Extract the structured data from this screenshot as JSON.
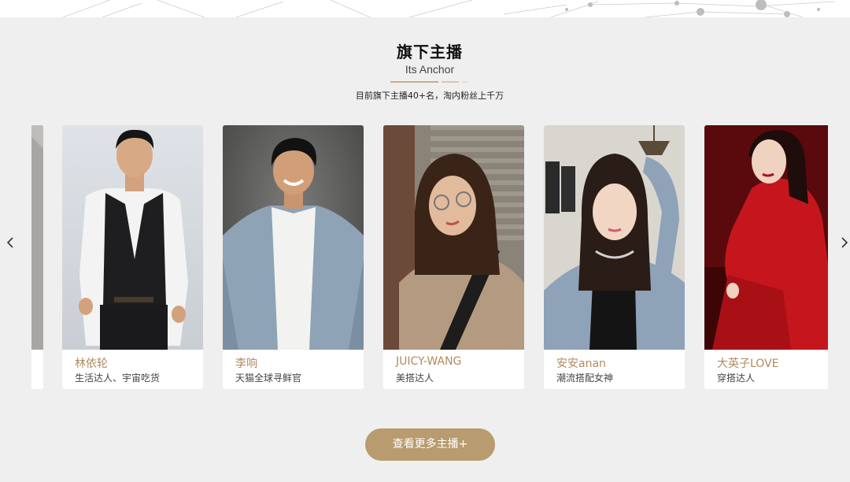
{
  "section": {
    "title": "旗下主播",
    "subtitle": "Its Anchor",
    "description": "目前旗下主播40+名，淘内粉丝上千万"
  },
  "carousel": {
    "prev_icon": "chevron-left-icon",
    "next_icon": "chevron-right-icon",
    "anchors": [
      {
        "name": "林依轮",
        "role": "生活达人、宇宙吃货"
      },
      {
        "name": "李响",
        "role": "天猫全球寻鲜官"
      },
      {
        "name": "JUICY-WANG",
        "role": "美搭达人"
      },
      {
        "name": "安安anan",
        "role": "潮流搭配女神"
      },
      {
        "name": "大英子LOVE",
        "role": "穿搭达人"
      }
    ]
  },
  "more_button": {
    "label": "查看更多主播+"
  },
  "colors": {
    "accent": "#b89b6e",
    "name_text": "#b08a5e",
    "background": "#efefef"
  }
}
